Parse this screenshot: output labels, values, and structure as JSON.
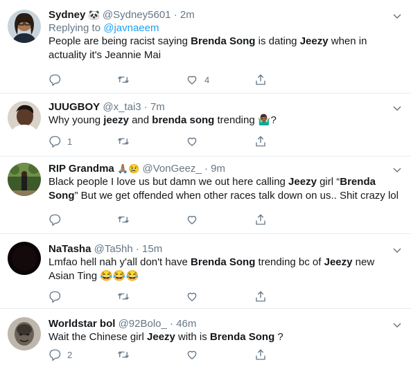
{
  "tweets": [
    {
      "name": "Sydney",
      "name_emoji": "🐼",
      "handle": "@Sydney5601",
      "sep": "·",
      "time": "2m",
      "replying_label": "Replying to",
      "replying_handle": "@javnaeem",
      "text": {
        "p1": "People are being racist saying ",
        "b1": "Brenda Song",
        "p2": " is dating ",
        "b2": "Jeezy",
        "p3": " when in actuality it's Jeannie Mai"
      },
      "counts": {
        "reply": "",
        "retweet": "",
        "like": "4"
      }
    },
    {
      "name": "JUUGBOY",
      "handle": "@x_tai3",
      "sep": "·",
      "time": "7m",
      "text": {
        "p1": "Why young ",
        "b1": "jeezy",
        "p2": " and ",
        "b2": "brenda song",
        "p3": " trending 🤷🏾‍♂️?"
      },
      "counts": {
        "reply": "1",
        "retweet": "",
        "like": ""
      }
    },
    {
      "name": "RIP Grandma",
      "name_emoji": "🙏🏽😢",
      "handle": "@VonGeez_",
      "sep": "·",
      "time": "9m",
      "text": {
        "p1": "Black people I love us but damn we out here calling ",
        "b1": "Jeezy",
        "p2": " girl “",
        "b2": "Brenda Song",
        "p3": "” But we get offended when other races talk down on us.. Shit crazy lol"
      },
      "counts": {
        "reply": "",
        "retweet": "",
        "like": ""
      }
    },
    {
      "name": "NaTasha",
      "handle": "@Ta5hh",
      "sep": "·",
      "time": "15m",
      "text": {
        "p1": "Lmfao hell nah y'all don't have ",
        "b1": "Brenda Song",
        "p2": " trending bc of ",
        "b2": "Jeezy",
        "p3": " new Asian Ting 😂😂😂"
      },
      "counts": {
        "reply": "",
        "retweet": "",
        "like": ""
      }
    },
    {
      "name": "Worldstar bol",
      "handle": "@92Bolo_",
      "sep": "·",
      "time": "46m",
      "text": {
        "p1": "Wait the Chinese girl ",
        "b1": "Jeezy",
        "p2": " with is ",
        "b2": "Brenda Song",
        "p3": " ?"
      },
      "counts": {
        "reply": "2",
        "retweet": "",
        "like": ""
      }
    }
  ],
  "colors": {
    "text": "#14171a",
    "secondary": "#657786",
    "link": "#1da1f2",
    "divider": "#e6ecf0"
  },
  "icons": [
    "reply-icon",
    "retweet-icon",
    "like-icon",
    "share-icon",
    "chevron-down-icon"
  ]
}
